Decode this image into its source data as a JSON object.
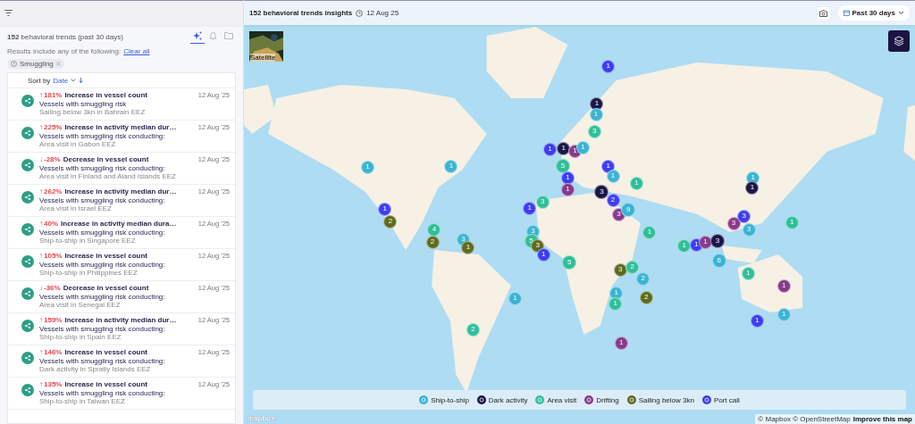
{
  "sidebar": {
    "summary": "**152** behavioral trends (past 30 days)",
    "tabs": [
      {
        "kind": "sparkle",
        "selected": true
      },
      {
        "kind": "bell",
        "selected": false
      },
      {
        "kind": "folder",
        "selected": false
      }
    ],
    "filter_caption": "Results include any of the following:",
    "clear_link": "Clear all",
    "chips": [
      {
        "label": "Smuggling"
      }
    ],
    "sort": {
      "label": "Sort by",
      "value": "Date"
    },
    "items": [
      {
        "arrow": "↑",
        "change": "181%",
        "title": "Increase in vessel count",
        "subtitle": "Vessels with smuggling risk",
        "detail": "Sailing below 3kn in Bahrain EEZ",
        "date": "12 Aug '25"
      },
      {
        "arrow": "↑",
        "change": "225%",
        "title": "Increase in activity median dur…",
        "subtitle": "Vessels with smuggling risk conducting:",
        "detail": "Area visit in Gabon EEZ",
        "date": "12 Aug '25"
      },
      {
        "arrow": "↓",
        "change": "-28%",
        "title": "Decrease in vessel count",
        "subtitle": "Vessels with smuggling risk conducting:",
        "detail": "Area visit in Finland and Aland Islands EEZ",
        "date": "12 Aug '25"
      },
      {
        "arrow": "↑",
        "change": "262%",
        "title": "Increase in activity median dur…",
        "subtitle": "Vessels with smuggling risk conducting:",
        "detail": "Area visit in Israel EEZ",
        "date": "12 Aug '25"
      },
      {
        "arrow": "↑",
        "change": "40%",
        "title": "Increase in activity median dura…",
        "subtitle": "Vessels with smuggling risk conducting:",
        "detail": "Ship-to-ship in Singapore EEZ",
        "date": "12 Aug '25"
      },
      {
        "arrow": "↑",
        "change": "105%",
        "title": "Increase in vessel count",
        "subtitle": "Vessels with smuggling risk conducting:",
        "detail": "Ship-to-ship in Philippines EEZ",
        "date": "12 Aug '25"
      },
      {
        "arrow": "↓",
        "change": "-36%",
        "title": "Decrease in vessel count",
        "subtitle": "Vessels with smuggling risk conducting:",
        "detail": "Area visit in Senegal EEZ",
        "date": "12 Aug '25"
      },
      {
        "arrow": "↑",
        "change": "159%",
        "title": "Increase in activity median dur…",
        "subtitle": "Vessels with smuggling risk conducting:",
        "detail": "Ship-to-ship in Spain EEZ",
        "date": "12 Aug '25"
      },
      {
        "arrow": "↑",
        "change": "146%",
        "title": "Increase in vessel count",
        "subtitle": "Vessels with smuggling risk conducting:",
        "detail": "Dark activity in Spratly Islands EEZ",
        "date": "12 Aug '25"
      },
      {
        "arrow": "↑",
        "change": "135%",
        "title": "Increase in vessel count",
        "subtitle": "Vessels with smuggling risk conducting:",
        "detail": "Ship-to-ship in Taiwan EEZ",
        "date": "12 Aug '25"
      }
    ]
  },
  "header": {
    "title": "152 behavioral trends insights",
    "date": "12 Aug 25",
    "range": "Past 30 days"
  },
  "map": {
    "satellite_label": "Satellite",
    "markers": [
      {
        "count": "1",
        "color": "#3d3df2"
      },
      {
        "count": "1",
        "color": "#1c1648"
      },
      {
        "count": "1",
        "color": "#3ab4d4"
      },
      {
        "count": "3",
        "color": "#2fbf9a"
      },
      {
        "count": "1",
        "color": "#3d3df2"
      },
      {
        "count": "1",
        "color": "#1c1648"
      },
      {
        "count": "1",
        "color": "#873a8a"
      },
      {
        "count": "1",
        "color": "#3ab4d4"
      },
      {
        "count": "5",
        "color": "#2fbf9a"
      },
      {
        "count": "1",
        "color": "#3d3df2"
      },
      {
        "count": "1",
        "color": "#3ab4d4"
      },
      {
        "count": "1",
        "color": "#3d3df2"
      },
      {
        "count": "1",
        "color": "#873a8a"
      },
      {
        "count": "3",
        "color": "#1c1648"
      },
      {
        "count": "2",
        "color": "#3d3df2"
      },
      {
        "count": "1",
        "color": "#2fbf9a"
      },
      {
        "count": "1",
        "color": "#3ab4d4"
      },
      {
        "count": "1",
        "color": "#3ab4d4"
      },
      {
        "count": "1",
        "color": "#3d3df2"
      },
      {
        "count": "2",
        "color": "#5f6b1e"
      },
      {
        "count": "4",
        "color": "#2fbf9a"
      },
      {
        "count": "2",
        "color": "#5f6b1e"
      },
      {
        "count": "3",
        "color": "#3ab4d4"
      },
      {
        "count": "1",
        "color": "#5f6b1e"
      },
      {
        "count": "1",
        "color": "#3d3df2"
      },
      {
        "count": "3",
        "color": "#2fbf9a"
      },
      {
        "count": "3",
        "color": "#3ab4d4"
      },
      {
        "count": "5",
        "color": "#2fbf9a"
      },
      {
        "count": "3",
        "color": "#5f6b1e"
      },
      {
        "count": "1",
        "color": "#3d3df2"
      },
      {
        "count": "5",
        "color": "#2fbf9a"
      },
      {
        "count": "3",
        "color": "#873a8a"
      },
      {
        "count": "9",
        "color": "#3ab4d4"
      },
      {
        "count": "1",
        "color": "#2fbf9a"
      },
      {
        "count": "1",
        "color": "#2fbf9a"
      },
      {
        "count": "1",
        "color": "#3d3df2"
      },
      {
        "count": "1",
        "color": "#873a8a"
      },
      {
        "count": "3",
        "color": "#1c1648"
      },
      {
        "count": "3",
        "color": "#873a8a"
      },
      {
        "count": "3",
        "color": "#3d3df2"
      },
      {
        "count": "3",
        "color": "#3ab4d4"
      },
      {
        "count": "6",
        "color": "#3ab4d4"
      },
      {
        "count": "1",
        "color": "#3ab4d4"
      },
      {
        "count": "1",
        "color": "#1c1648"
      },
      {
        "count": "1",
        "color": "#2fbf9a"
      },
      {
        "count": "3",
        "color": "#5f6b1e"
      },
      {
        "count": "2",
        "color": "#2fbf9a"
      },
      {
        "count": "2",
        "color": "#3ab4d4"
      },
      {
        "count": "1",
        "color": "#3ab4d4"
      },
      {
        "count": "2",
        "color": "#5f6b1e"
      },
      {
        "count": "1",
        "color": "#2fbf9a"
      },
      {
        "count": "1",
        "color": "#2fbf9a"
      },
      {
        "count": "1",
        "color": "#873a8a"
      },
      {
        "count": "1",
        "color": "#3ab4d4"
      },
      {
        "count": "1",
        "color": "#3d3df2"
      },
      {
        "count": "2",
        "color": "#2fbf9a"
      },
      {
        "count": "1",
        "color": "#3ab4d4"
      },
      {
        "count": "1",
        "color": "#873a8a"
      }
    ],
    "legend": [
      {
        "label": "Ship-to-ship",
        "color": "#3ab4d4"
      },
      {
        "label": "Dark activity",
        "color": "#1c1648"
      },
      {
        "label": "Area visit",
        "color": "#2fbf9a"
      },
      {
        "label": "Drifting",
        "color": "#873a8a"
      },
      {
        "label": "Sailing below 3kn",
        "color": "#5f6b1e"
      },
      {
        "label": "Port call",
        "color": "#3d3df2"
      }
    ],
    "logo": "mapbox",
    "attribution": "© Mapbox © OpenStreetMap",
    "improve_link": "Improve this map"
  }
}
